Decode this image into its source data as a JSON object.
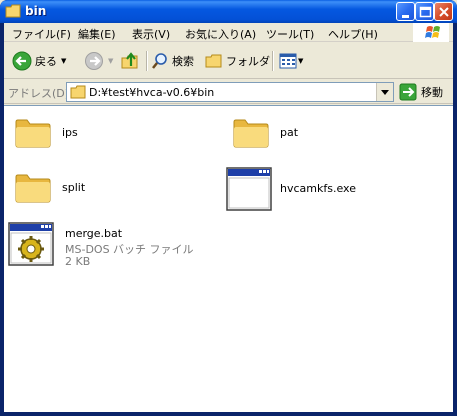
{
  "window": {
    "title": "bin"
  },
  "menu": {
    "items": [
      "ファイル(F)",
      "編集(E)",
      "表示(V)",
      "お気に入り(A)",
      "ツール(T)",
      "ヘルプ(H)"
    ]
  },
  "toolbar": {
    "back_label": "戻る",
    "search_label": "検索",
    "folders_label": "フォルダ"
  },
  "address": {
    "label": "アドレス(D)",
    "path": "D:¥test¥hvca-v0.6¥bin",
    "go_label": "移動"
  },
  "files": [
    {
      "name": "ips",
      "type": "folder"
    },
    {
      "name": "pat",
      "type": "folder"
    },
    {
      "name": "split",
      "type": "folder"
    },
    {
      "name": "hvcamkfs.exe",
      "type": "exe"
    },
    {
      "name": "merge.bat",
      "type": "bat",
      "description": "MS-DOS バッチ ファイル",
      "size": "2 KB"
    }
  ],
  "colors": {
    "titlebar": "#0558E0",
    "folder": "#F7D56E"
  }
}
